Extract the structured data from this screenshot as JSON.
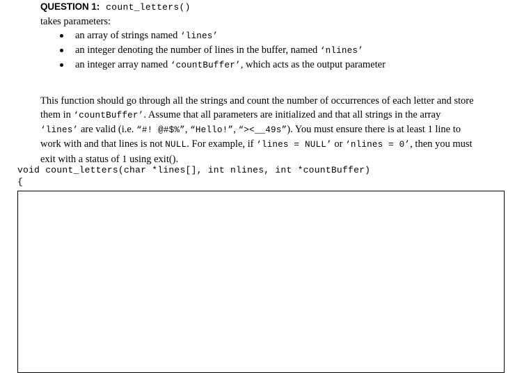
{
  "question": {
    "label": "QUESTION 1:",
    "function_name": "count_letters()",
    "intro": "takes parameters:",
    "parameters": [
      {
        "pre": "an array of strings named ",
        "code": "‘lines’",
        "post": ""
      },
      {
        "pre": "an integer denoting the number of lines in the buffer, named ",
        "code": "‘nlines’",
        "post": ""
      },
      {
        "pre": "an integer array named ",
        "code": "‘countBuffer’",
        "post": ", which acts as the output parameter"
      }
    ],
    "description": {
      "s1": "This function should go through all the strings and count the number of occurrences of each letter and store them in ",
      "c1": "‘countBuffer’",
      "s2": ". Assume that all parameters are initialized and that all strings in the array ",
      "c2": "‘lines’",
      "s3": " are valid (i.e. ",
      "c3": "“#! @#$%”",
      "s4": ", ",
      "c4": "“Hello!”",
      "s5": ", ",
      "c5": "“><__49s”",
      "s6": ").  You must ensure there is at least 1 line to work with and that lines is not ",
      "c6": "NULL",
      "s7": ".  For example, if  ",
      "c7": "‘lines = NULL’",
      "s8": " or ",
      "c8": "‘nlines = 0’",
      "s9": ", then you must exit with a status of 1 using exit()."
    },
    "signature": "void count_letters(char *lines[], int nlines, int *countBuffer)",
    "open_brace": "{",
    "answer_area_label": "answer-area"
  },
  "colors": {
    "text": "#000000",
    "box_border": "#000000",
    "page_background": "#ffffff"
  }
}
